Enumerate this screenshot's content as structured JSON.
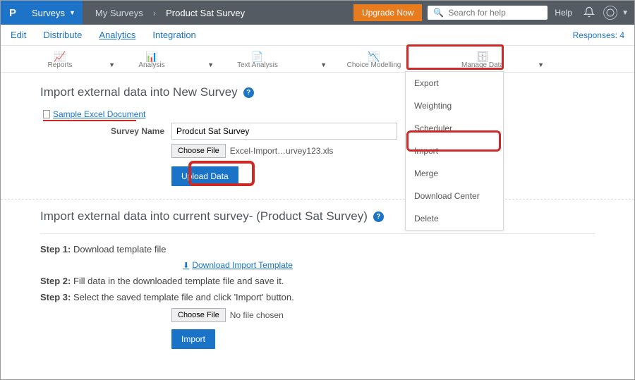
{
  "topbar": {
    "logo_letter": "P",
    "surveys_label": "Surveys",
    "breadcrumb1": "My Surveys",
    "breadcrumb2": "Product Sat Survey",
    "upgrade": "Upgrade Now",
    "search_placeholder": "Search for help",
    "help": "Help"
  },
  "tabs": {
    "edit": "Edit",
    "distribute": "Distribute",
    "analytics": "Analytics",
    "integration": "Integration",
    "responses": "Responses: 4"
  },
  "toolbar": {
    "reports": "Reports",
    "analysis": "Analysis",
    "text_analysis": "Text Analysis",
    "choice": "Choice Modelling",
    "manage": "Manage Data"
  },
  "dd": {
    "export": "Export",
    "weighting": "Weighting",
    "scheduler": "Scheduler",
    "import": "Import",
    "merge": "Merge",
    "download_center": "Download Center",
    "delete": "Delete"
  },
  "panel1": {
    "title": "Import external data into New Survey",
    "sample_link": "Sample Excel Document",
    "survey_name_label": "Survey Name",
    "survey_name_value": "Prodcut Sat Survey",
    "choose_file": "Choose File",
    "file_name": "Excel-Import…urvey123.xls",
    "upload": "Upload Data"
  },
  "panel2": {
    "title": "Import external data into current survey- (Product Sat Survey)",
    "step1_label": "Step 1:",
    "step1_text": " Download template file",
    "download_tmpl": "Download Import Template",
    "step2_label": "Step 2:",
    "step2_text": " Fill data in the downloaded template file and save it.",
    "step3_label": "Step 3:",
    "step3_text": " Select the saved template file and click 'Import' button.",
    "choose_file": "Choose File",
    "no_file": "No file chosen",
    "import": "Import"
  }
}
